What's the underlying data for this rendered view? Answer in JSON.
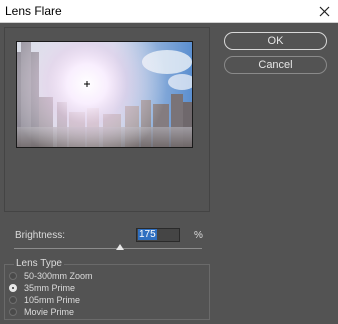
{
  "dialog": {
    "title": "Lens Flare",
    "close_icon": "close-icon"
  },
  "buttons": {
    "ok_label": "OK",
    "cancel_label": "Cancel"
  },
  "brightness": {
    "label": "Brightness:",
    "value": "175",
    "unit": "%",
    "slider_level_percent": 175
  },
  "lens_type": {
    "legend": "Lens Type",
    "options": [
      {
        "label": "50-300mm Zoom",
        "checked": false
      },
      {
        "label": "35mm Prime",
        "checked": true
      },
      {
        "label": "105mm Prime",
        "checked": false
      },
      {
        "label": "Movie Prime",
        "checked": false
      }
    ]
  },
  "colors": {
    "background": "#535353",
    "titlebar": "#ffffff",
    "selection": "#2f6fc0"
  }
}
